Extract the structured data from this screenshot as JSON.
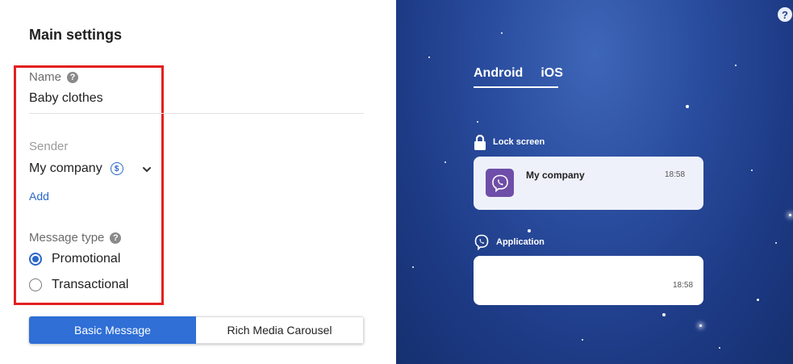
{
  "main_settings": {
    "title": "Main settings",
    "name_label": "Name",
    "name_value": "Baby clothes",
    "sender_label": "Sender",
    "sender_value": "My company",
    "coin_symbol": "$",
    "add_label": "Add",
    "message_type_label": "Message type",
    "message_types": [
      {
        "label": "Promotional",
        "checked": true
      },
      {
        "label": "Transactional",
        "checked": false
      }
    ],
    "format_buttons": [
      {
        "label": "Basic Message",
        "active": true
      },
      {
        "label": "Rich Media Carousel",
        "active": false
      }
    ]
  },
  "preview": {
    "help_symbol": "?",
    "tabs": [
      {
        "label": "Android",
        "active": true
      },
      {
        "label": "iOS",
        "active": false
      }
    ],
    "lock_screen": {
      "label": "Lock screen",
      "sender": "My company",
      "time": "18:58"
    },
    "application": {
      "label": "Application",
      "time": "18:58"
    }
  },
  "colors": {
    "accent": "#2f6fd6",
    "highlight": "#e32020",
    "viber": "#6e4ea8",
    "preview_bg": "#2b4ea0"
  },
  "icons": [
    "help-icon",
    "coin-icon",
    "chevron-down-icon",
    "lock-icon",
    "viber-icon"
  ]
}
